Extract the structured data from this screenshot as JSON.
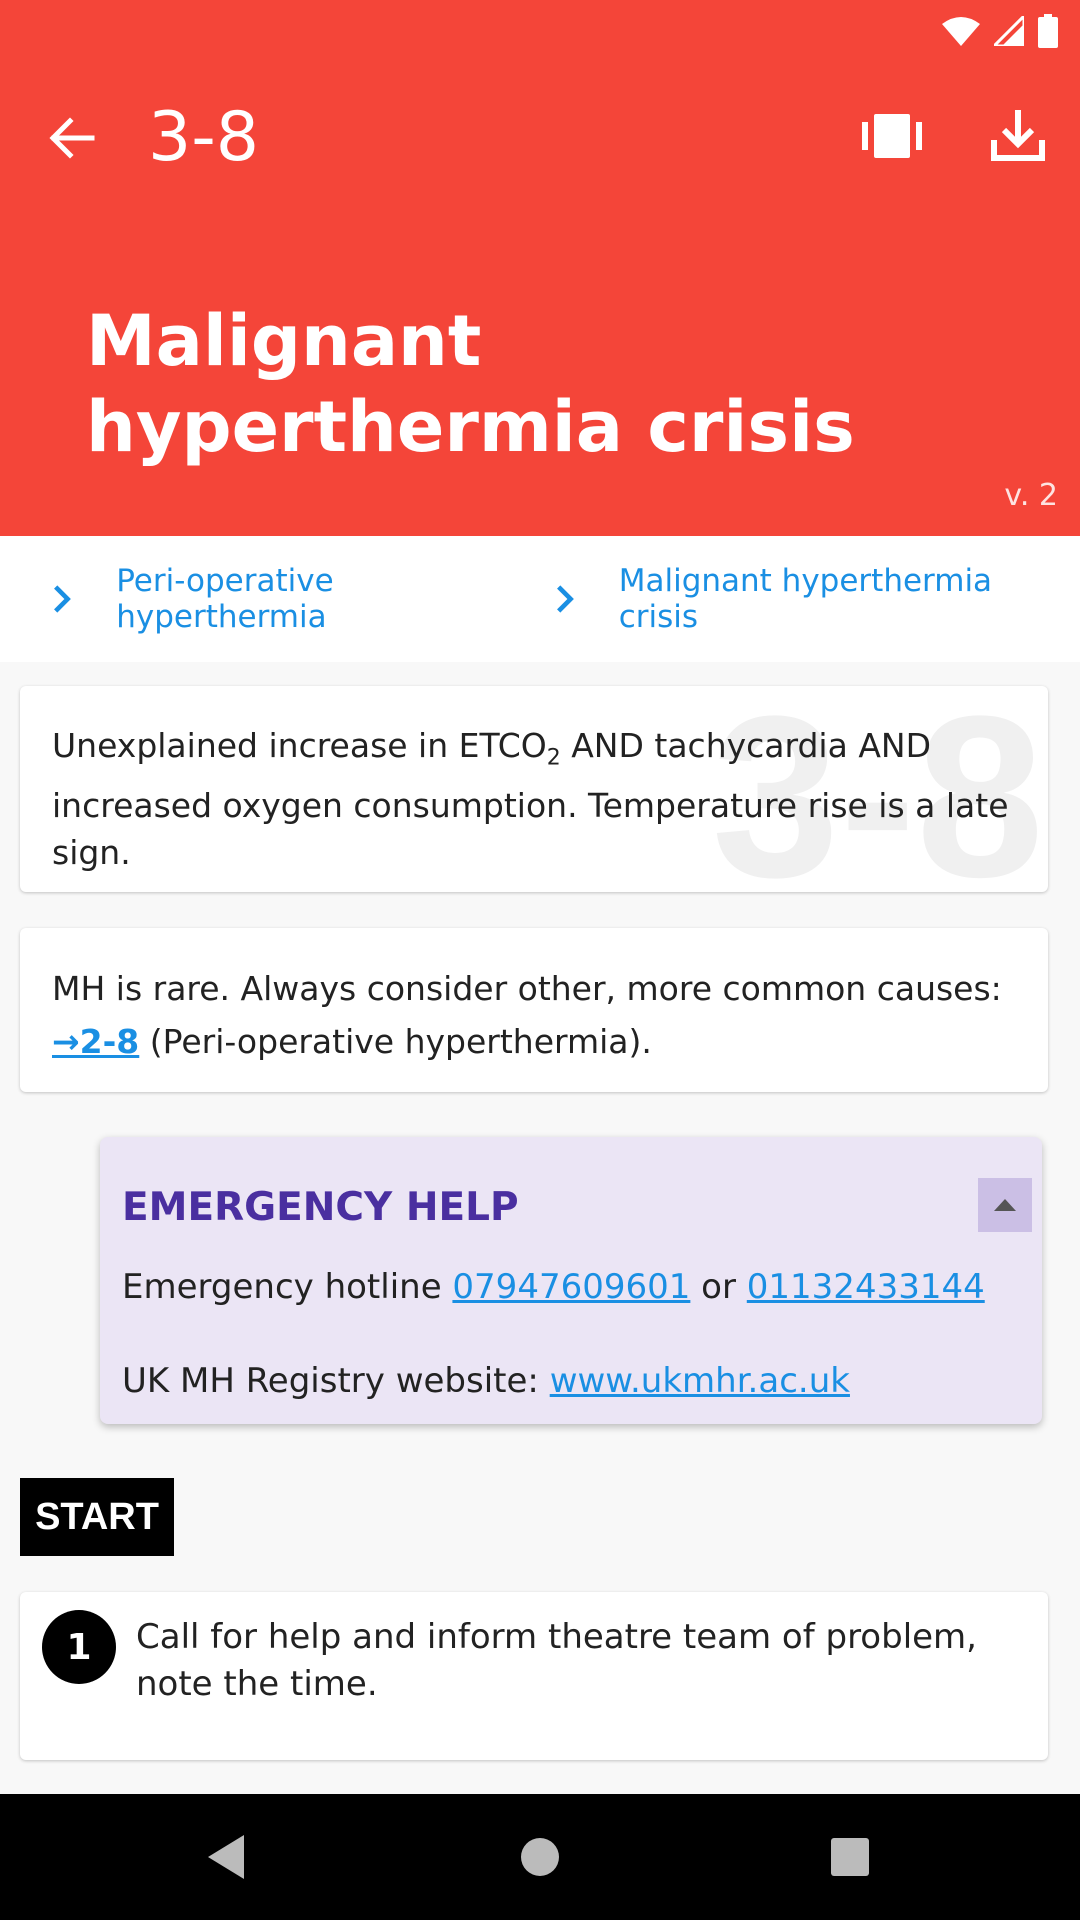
{
  "toolbar": {
    "title": "3-8"
  },
  "page": {
    "heading": "Malignant hyperthermia crisis",
    "version": "v. 2"
  },
  "breadcrumb": [
    {
      "label": "Peri-operative hyperthermia"
    },
    {
      "label": "Malignant hyperthermia crisis"
    }
  ],
  "card1": {
    "text_part1": "Unexplained increase in ETCO",
    "subscript": "2",
    "text_part2": " AND tachycardia AND increased oxygen consumption. Temperature rise is a late sign.",
    "watermark": "3-8"
  },
  "card2": {
    "text_part1": "MH is rare. Always consider other, more common causes: ",
    "link": "→2-8",
    "text_part2": " (Peri-operative hyperthermia)."
  },
  "emergency": {
    "title": "EMERGENCY HELP",
    "hotline_label": "Emergency hotline ",
    "phone1": "07947609601",
    "or": " or ",
    "phone2": "01132433144",
    "website_label": "UK MH Registry website: ",
    "website": "www.ukmhr.ac.uk"
  },
  "start_label": "START",
  "steps": [
    {
      "number": "1",
      "text": "Call for help and inform theatre team of problem, note the time."
    }
  ],
  "colors": {
    "header": "#f44539",
    "link": "#1a8fe3",
    "emergency_bg": "#ebe5f5",
    "emergency_title": "#4a2fa0"
  },
  "icons": {
    "back": "arrow-left-icon",
    "action1": "carousel-icon",
    "action2": "download-icon",
    "breadcrumb_sep": "chevron-right-icon",
    "toggle": "triangle-up-icon",
    "nav_back": "triangle-back-icon",
    "nav_home": "circle-home-icon",
    "nav_recents": "square-recents-icon"
  }
}
